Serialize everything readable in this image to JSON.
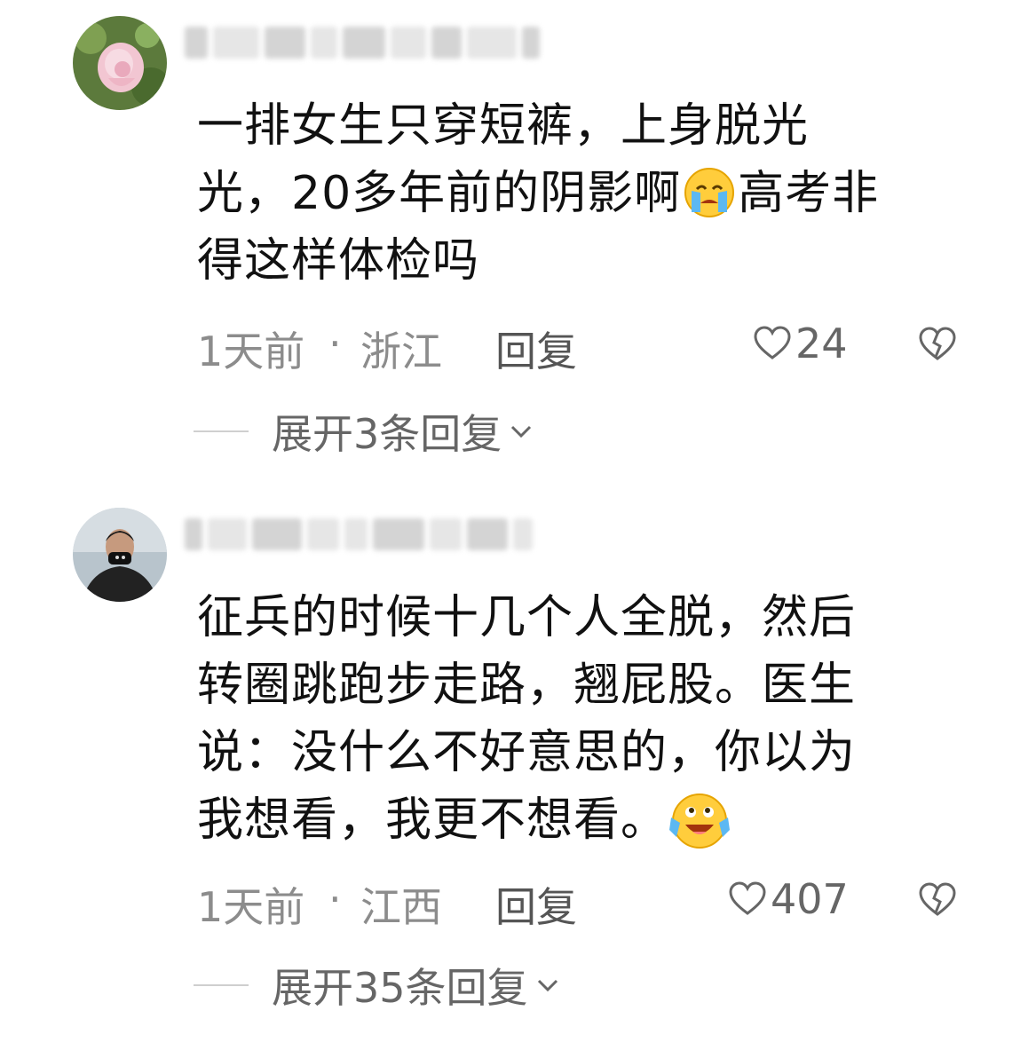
{
  "comments": [
    {
      "text_line1": "一排女生只穿短裤，上身脱光",
      "text_line2a": "光，20多年前的阴影啊",
      "text_line2b": "高考非",
      "text_line3": "得这样体检吗",
      "emoji": "crying-emoji",
      "time": "1天前",
      "separator": "·",
      "location": "浙江",
      "reply_label": "回复",
      "likes": "24",
      "expand_label": "展开3条回复"
    },
    {
      "text_line1": "征兵的时候十几个人全脱，然后",
      "text_line2": "转圈跳跑步走路，翘屁股。医生",
      "text_line3": "说：没什么不好意思的，你以为",
      "text_line4": "我想看，我更不想看。",
      "emoji": "laugh-cry-emoji",
      "time": "1天前",
      "separator": "·",
      "location": "江西",
      "reply_label": "回复",
      "likes": "407",
      "expand_label": "展开35条回复"
    }
  ]
}
